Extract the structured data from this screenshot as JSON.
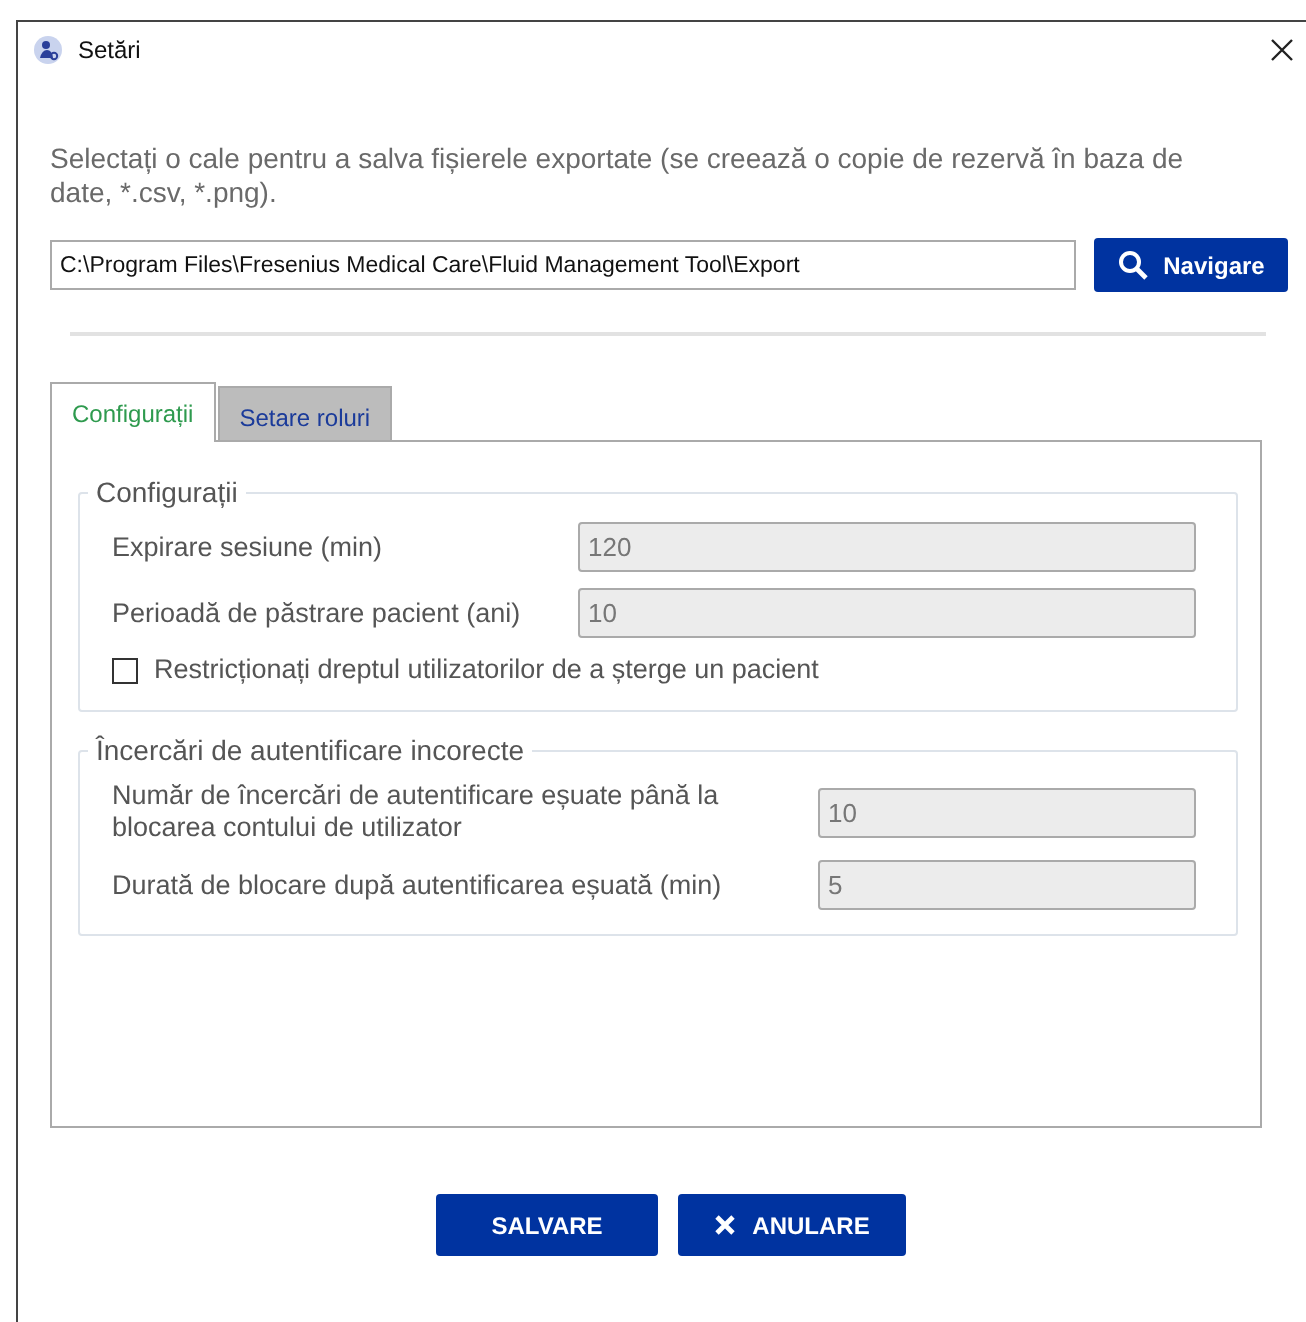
{
  "window": {
    "title": "Setări"
  },
  "export": {
    "instruction": "Selectați o cale pentru a salva fișierele exportate (se creează o copie de rezervă în baza de date, *.csv, *.png).",
    "path": "C:\\Program Files\\Fresenius Medical Care\\Fluid Management Tool\\Export",
    "browse_button": "Navigare"
  },
  "tabs": [
    {
      "label": "Configurații",
      "selected": true
    },
    {
      "label": "Setare roluri",
      "selected": false
    }
  ],
  "groups": [
    {
      "title": "Configurații",
      "fields": [
        {
          "kind": "input",
          "label": "Expirare sesiune (min)",
          "value": "120",
          "disabled": true
        },
        {
          "kind": "input",
          "label": "Perioadă de păstrare pacient (ani)",
          "value": "10",
          "disabled": true
        },
        {
          "kind": "checkbox",
          "label": "Restricționați dreptul utilizatorilor de a șterge un pacient",
          "checked": false
        }
      ]
    },
    {
      "title": "Încercări de autentificare incorecte",
      "fields": [
        {
          "kind": "input",
          "label": "Număr de încercări de autentificare eșuate până la blocarea contului de utilizator",
          "value": "10",
          "disabled": true
        },
        {
          "kind": "input",
          "label": "Durată de blocare după autentificarea eșuată (min)",
          "value": "5",
          "disabled": true
        }
      ]
    }
  ],
  "buttons": [
    {
      "kind": "save",
      "label": "SALVARE"
    },
    {
      "kind": "cancel",
      "label": "ANULARE"
    }
  ]
}
